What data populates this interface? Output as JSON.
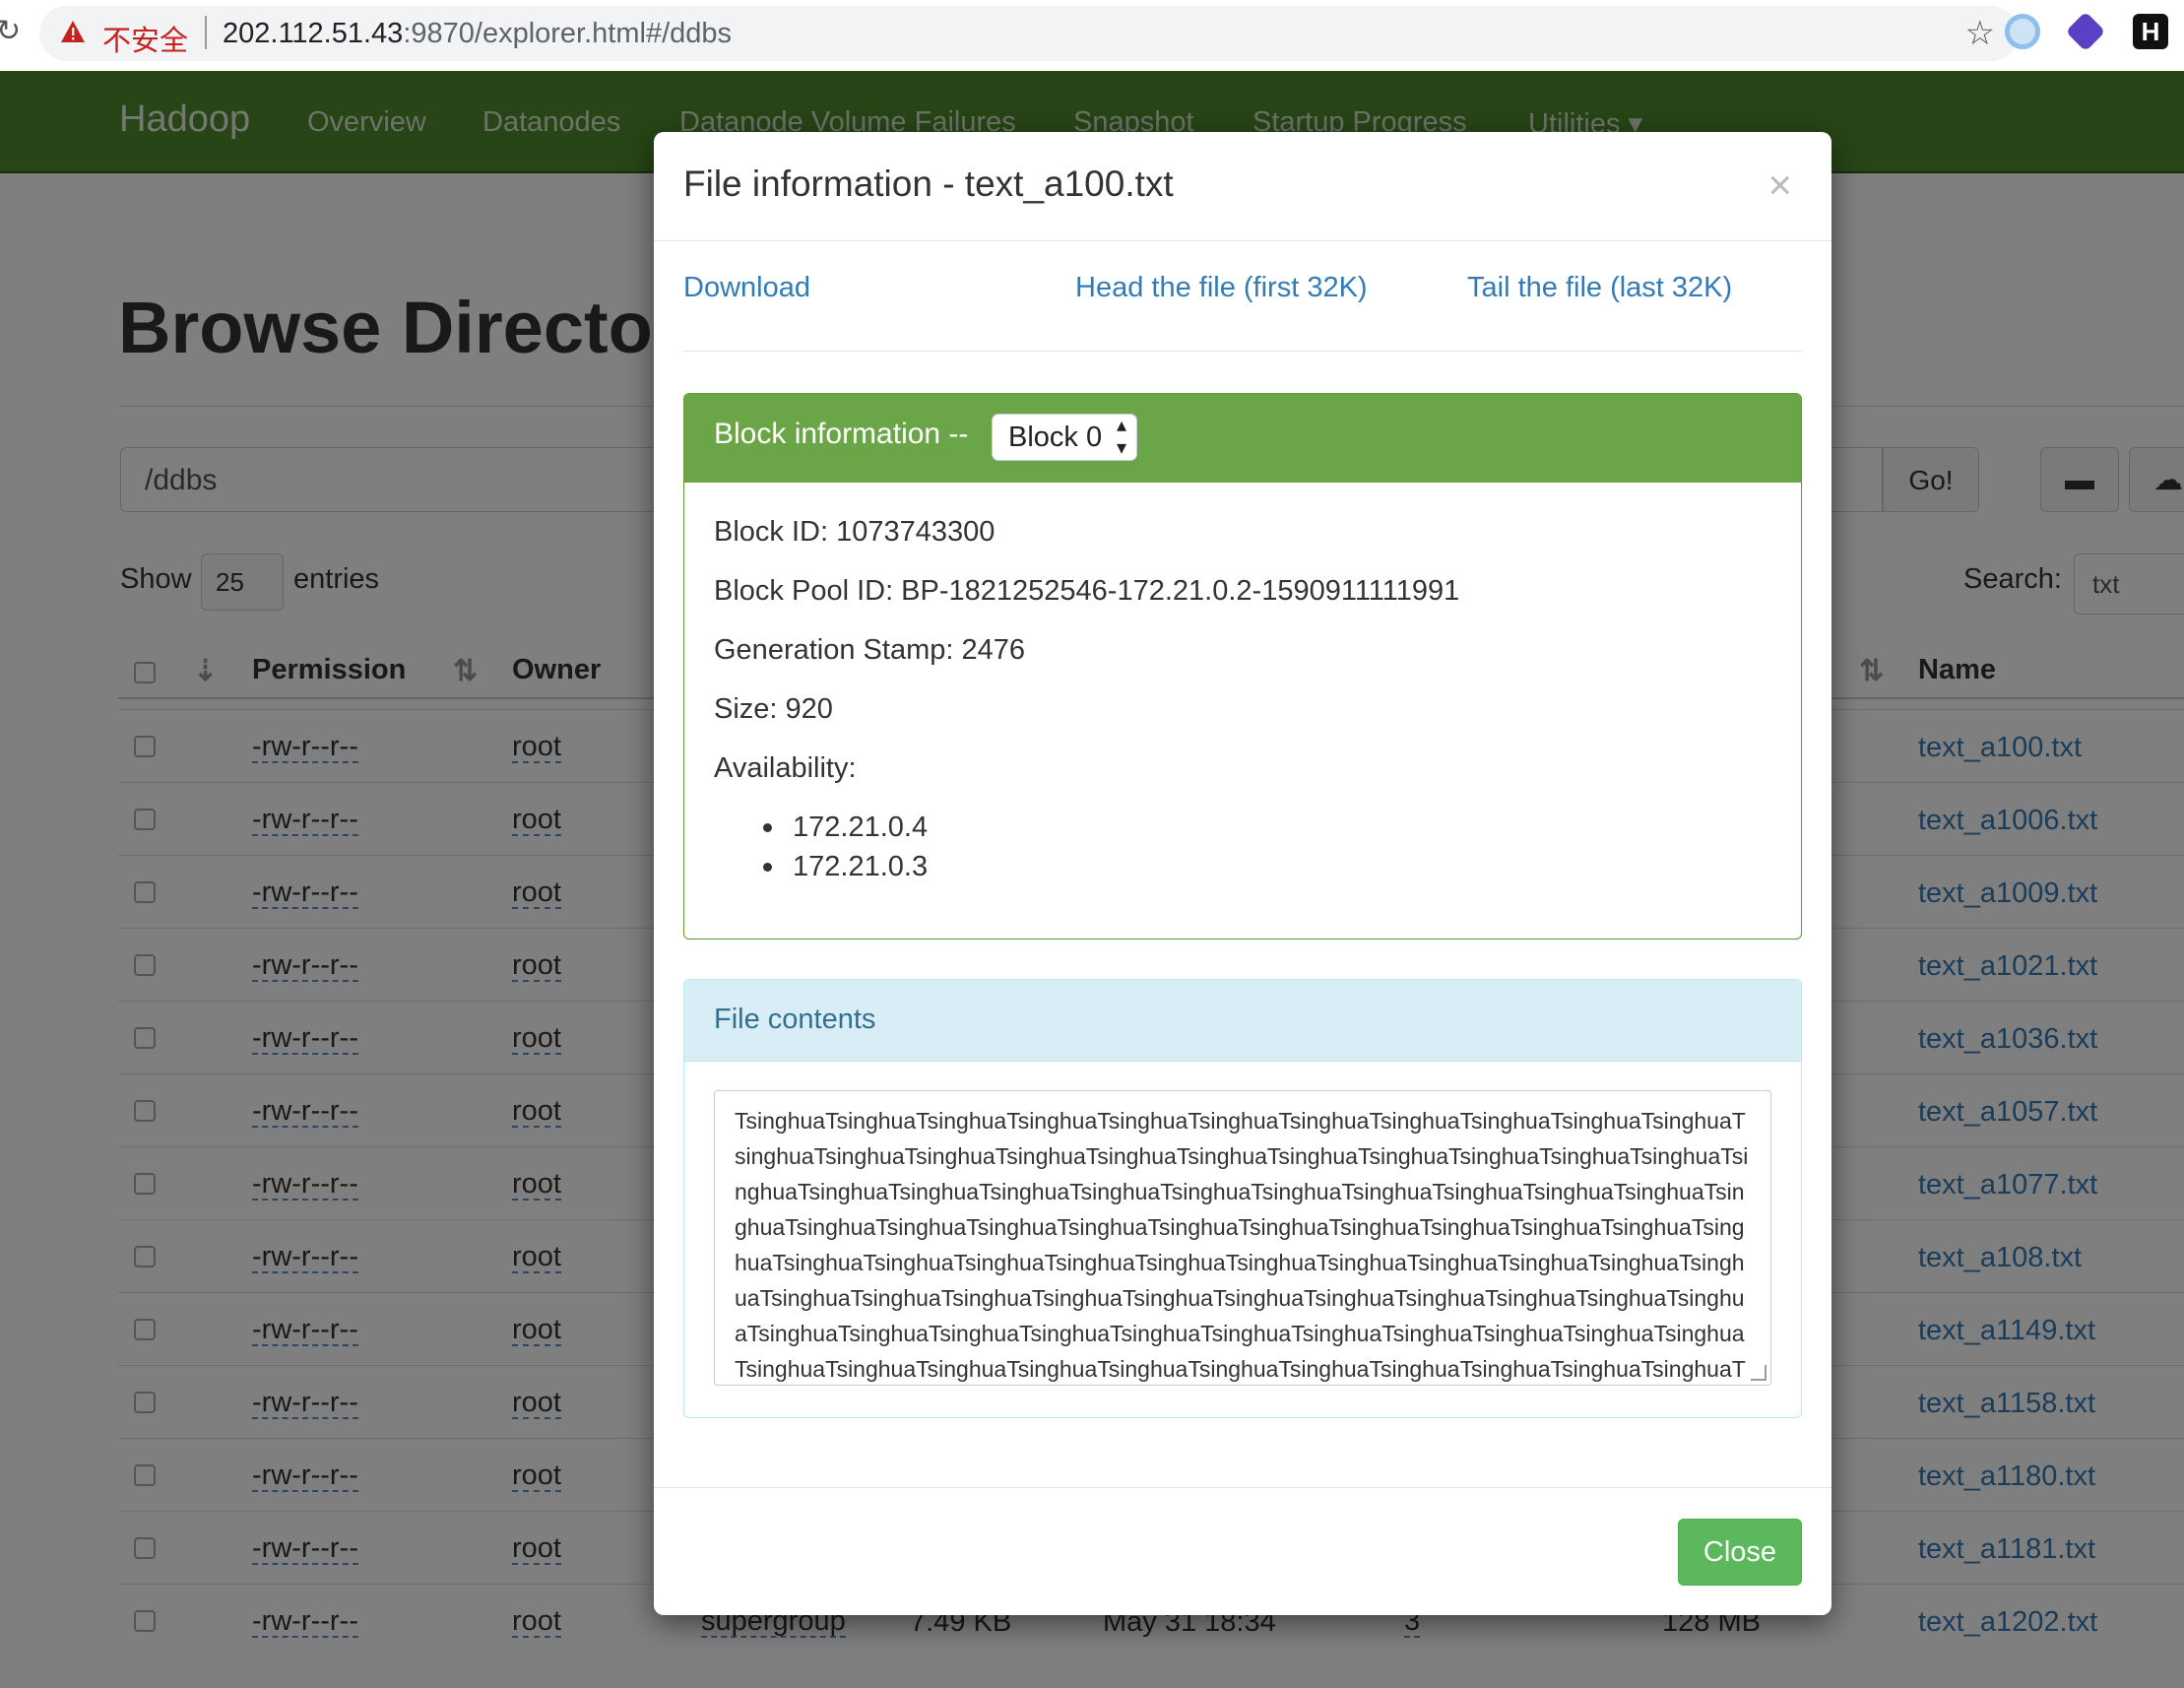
{
  "browser": {
    "security_label": "不安全",
    "url_host": "202.112.51.43",
    "url_rest": ":9870/explorer.html#/ddbs"
  },
  "navbar": {
    "brand": "Hadoop",
    "items": [
      "Overview",
      "Datanodes",
      "Datanode Volume Failures",
      "Snapshot",
      "Startup Progress",
      "Utilities"
    ]
  },
  "page": {
    "title": "Browse Directory",
    "path": "/ddbs",
    "go_label": "Go!",
    "show_label": "Show",
    "entries_value": "25",
    "entries_label": "entries",
    "search_label": "Search:",
    "search_value": "txt"
  },
  "table": {
    "headers": {
      "permission": "Permission",
      "owner": "Owner",
      "name": "Name"
    },
    "rows": [
      {
        "permission": "-rw-r--r--",
        "owner": "root",
        "name": "text_a100.txt"
      },
      {
        "permission": "-rw-r--r--",
        "owner": "root",
        "name": "text_a1006.txt"
      },
      {
        "permission": "-rw-r--r--",
        "owner": "root",
        "name": "text_a1009.txt"
      },
      {
        "permission": "-rw-r--r--",
        "owner": "root",
        "name": "text_a1021.txt"
      },
      {
        "permission": "-rw-r--r--",
        "owner": "root",
        "name": "text_a1036.txt"
      },
      {
        "permission": "-rw-r--r--",
        "owner": "root",
        "name": "text_a1057.txt"
      },
      {
        "permission": "-rw-r--r--",
        "owner": "root",
        "name": "text_a1077.txt"
      },
      {
        "permission": "-rw-r--r--",
        "owner": "root",
        "name": "text_a108.txt"
      },
      {
        "permission": "-rw-r--r--",
        "owner": "root",
        "name": "text_a1149.txt"
      },
      {
        "permission": "-rw-r--r--",
        "owner": "root",
        "name": "text_a1158.txt"
      },
      {
        "permission": "-rw-r--r--",
        "owner": "root",
        "name": "text_a1180.txt"
      },
      {
        "permission": "-rw-r--r--",
        "owner": "root",
        "name": "text_a1181.txt"
      },
      {
        "permission": "-rw-r--r--",
        "owner": "root",
        "group": "supergroup",
        "size": "7.49 KB",
        "modified": "May 31 18:34",
        "replication": "3",
        "block_size": "128 MB",
        "name": "text_a1202.txt"
      }
    ]
  },
  "modal": {
    "title": "File information - text_a100.txt",
    "close_x": "×",
    "links": {
      "download": "Download",
      "head": "Head the file (first 32K)",
      "tail": "Tail the file (last 32K)"
    },
    "block": {
      "heading": "Block information --",
      "selected": "Block 0",
      "block_id": "Block ID: 1073743300",
      "pool_id": "Block Pool ID: BP-1821252546-172.21.0.2-1590911111991",
      "gen_stamp": "Generation Stamp: 2476",
      "size": "Size: 920",
      "availability_label": "Availability:",
      "availability": [
        "172.21.0.4",
        "172.21.0.3"
      ]
    },
    "contents": {
      "title": "File contents",
      "text": "TsinghuaTsinghuaTsinghuaTsinghuaTsinghuaTsinghuaTsinghuaTsinghuaTsinghuaTsinghuaTsinghuaTsinghuaTsinghuaTsinghuaTsinghuaTsinghuaTsinghuaTsinghuaTsinghuaTsinghuaTsinghuaTsinghuaTsinghuaTsinghuaTsinghuaTsinghuaTsinghuaTsinghuaTsinghuaTsinghuaTsinghuaTsinghuaTsinghuaTsinghuaTsinghuaTsinghuaTsinghuaTsinghuaTsinghuaTsinghuaTsinghuaTsinghuaTsinghuaTsinghuaTsinghuaTsinghuaTsinghuaTsinghuaTsinghuaTsinghuaTsinghuaTsinghuaTsinghuaTsinghuaTsinghuaTsinghuaTsinghuaTsinghuaTsinghuaTsinghuaTsinghuaTsinghuaTsinghuaTsinghuaTsinghuaTsinghuaTsinghuaTsinghuaTsinghuaTsinghuaTsinghuaTsinghuaTsinghuaTsinghuaTsinghuaTsinghuaTsinghuaTsinghuaTsinghuaTsinghuaTsinghuaTsinghuaTsinghuaTsinghuaTsinghuaTsinghuaTsinghuaTsinghuaTsinghuaTsinghuaTsinghuaTsinghuaTsinghuaTsinghuaTsinghuaTsinghuaTsinghuaTsinghuaTsinghuaTsinghuaTsinghuaTsinghuaT"
    },
    "close_button": "Close"
  }
}
